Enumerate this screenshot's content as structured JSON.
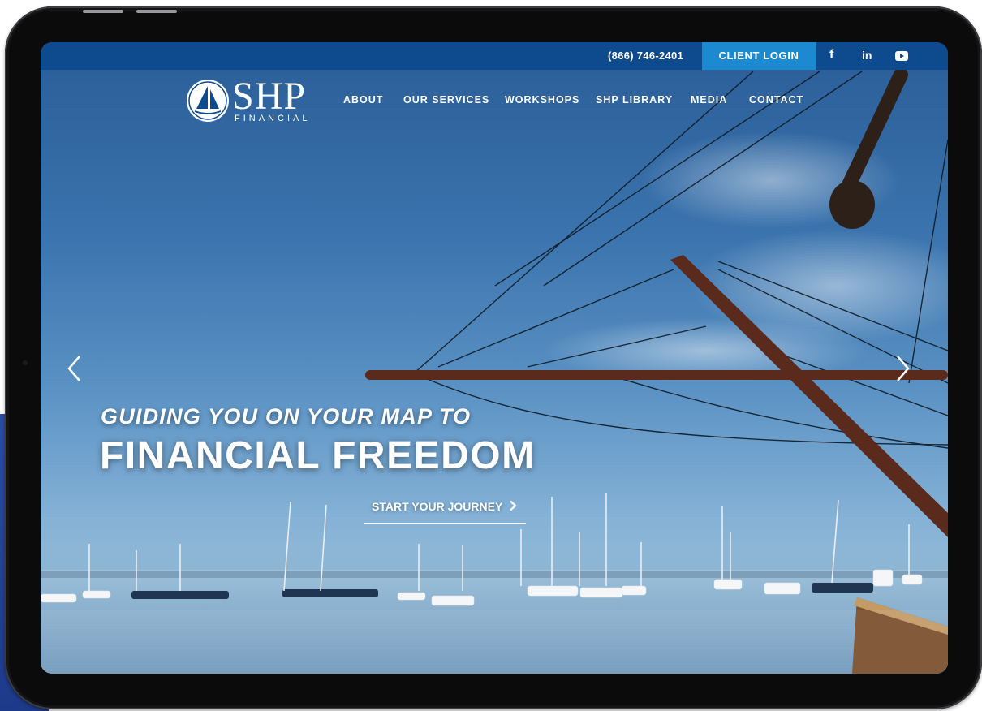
{
  "topbar": {
    "phone": "(866) 746-2401",
    "client_login": "CLIENT LOGIN",
    "social": [
      "f",
      "in",
      "youtube"
    ]
  },
  "logo": {
    "wordmark": "SHP",
    "subtitle": "FINANCIAL"
  },
  "nav": {
    "items": [
      "ABOUT",
      "OUR SERVICES",
      "WORKSHOPS",
      "SHP LIBRARY",
      "MEDIA",
      "CONTACT"
    ]
  },
  "hero": {
    "subtitle": "GUIDING YOU ON YOUR MAP TO",
    "title": "FINANCIAL FREEDOM",
    "cta": "START YOUR JOURNEY",
    "cta_icon": "chevron-right-icon"
  },
  "slider": {
    "prev_icon": "chevron-left-icon",
    "next_icon": "chevron-right-icon"
  },
  "colors": {
    "topbar": "#0e4a8e",
    "client_login": "#1c8ad0",
    "sky": "#3a73ad",
    "water": "#8fb2cc"
  }
}
